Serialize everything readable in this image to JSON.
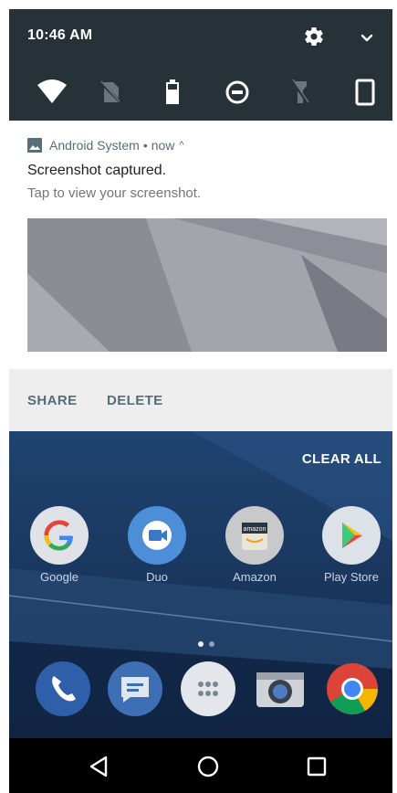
{
  "status": {
    "time": "10:46 AM"
  },
  "quick_settings": {
    "tiles": [
      {
        "icon": "wifi-icon",
        "state": "on"
      },
      {
        "icon": "no-sim-icon",
        "state": "off"
      },
      {
        "icon": "battery-icon",
        "state": "on"
      },
      {
        "icon": "do-not-disturb-icon",
        "state": "on"
      },
      {
        "icon": "flashlight-off-icon",
        "state": "off"
      },
      {
        "icon": "auto-rotate-icon",
        "state": "on"
      }
    ]
  },
  "notification": {
    "app": "Android System",
    "separator": "•",
    "time": "now",
    "caret": "^",
    "title": "Screenshot captured.",
    "text": "Tap to view your screenshot.",
    "actions": {
      "share": "SHARE",
      "delete": "DELETE"
    }
  },
  "home": {
    "clear_all": "CLEAR ALL",
    "apps": [
      {
        "label": "Google",
        "icon": "google-icon"
      },
      {
        "label": "Duo",
        "icon": "duo-icon"
      },
      {
        "label": "Amazon",
        "icon": "amazon-icon"
      },
      {
        "label": "Play Store",
        "icon": "play-store-icon"
      }
    ],
    "amazon_logo": "amazon",
    "dock": [
      {
        "icon": "phone-icon"
      },
      {
        "icon": "messages-icon"
      },
      {
        "icon": "app-drawer-icon"
      },
      {
        "icon": "camera-icon"
      },
      {
        "icon": "chrome-icon"
      }
    ]
  },
  "colors": {
    "qs_bg": "#263238",
    "accent": "#546e7a",
    "actions_bg": "#eeeeee",
    "home_bg": "#1a3659"
  }
}
